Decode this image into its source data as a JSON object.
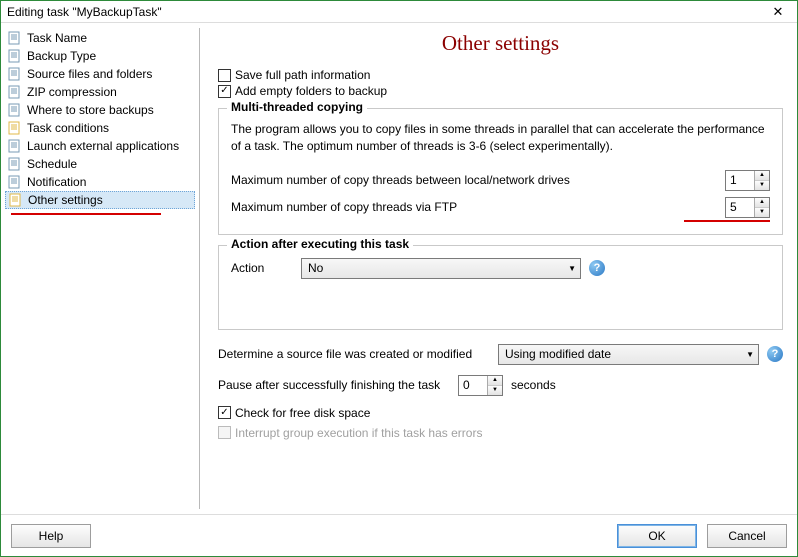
{
  "window": {
    "title": "Editing task \"MyBackupTask\""
  },
  "sidebar": {
    "items": [
      {
        "label": "Task Name"
      },
      {
        "label": "Backup Type"
      },
      {
        "label": "Source files and folders"
      },
      {
        "label": "ZIP compression"
      },
      {
        "label": "Where to store backups"
      },
      {
        "label": "Task conditions"
      },
      {
        "label": "Launch external applications"
      },
      {
        "label": "Schedule"
      },
      {
        "label": "Notification"
      },
      {
        "label": "Other settings"
      }
    ],
    "selected_index": 9
  },
  "main": {
    "title": "Other settings",
    "save_full_path_label": "Save full path information",
    "save_full_path_checked": false,
    "add_empty_folders_label": "Add empty folders to backup",
    "add_empty_folders_checked": true,
    "multithread": {
      "legend": "Multi-threaded copying",
      "description": "The program allows you to copy files in some threads in parallel that can accelerate the performance of a task. The optimum number of threads is 3-6 (select experimentally).",
      "local_label": "Maximum number of copy threads between local/network drives",
      "local_value": "1",
      "ftp_label": "Maximum number of copy threads via FTP",
      "ftp_value": "5"
    },
    "action_after": {
      "legend": "Action after executing this task",
      "action_label": "Action",
      "action_value": "No"
    },
    "determine_label": "Determine a source file was created or modified",
    "determine_value": "Using modified date",
    "pause_label": "Pause after successfully finishing the task",
    "pause_value": "0",
    "pause_unit": "seconds",
    "check_free_space_label": "Check for free disk space",
    "check_free_space_checked": true,
    "interrupt_label": "Interrupt group execution if this task has errors",
    "interrupt_checked": false
  },
  "footer": {
    "help": "Help",
    "ok": "OK",
    "cancel": "Cancel"
  }
}
